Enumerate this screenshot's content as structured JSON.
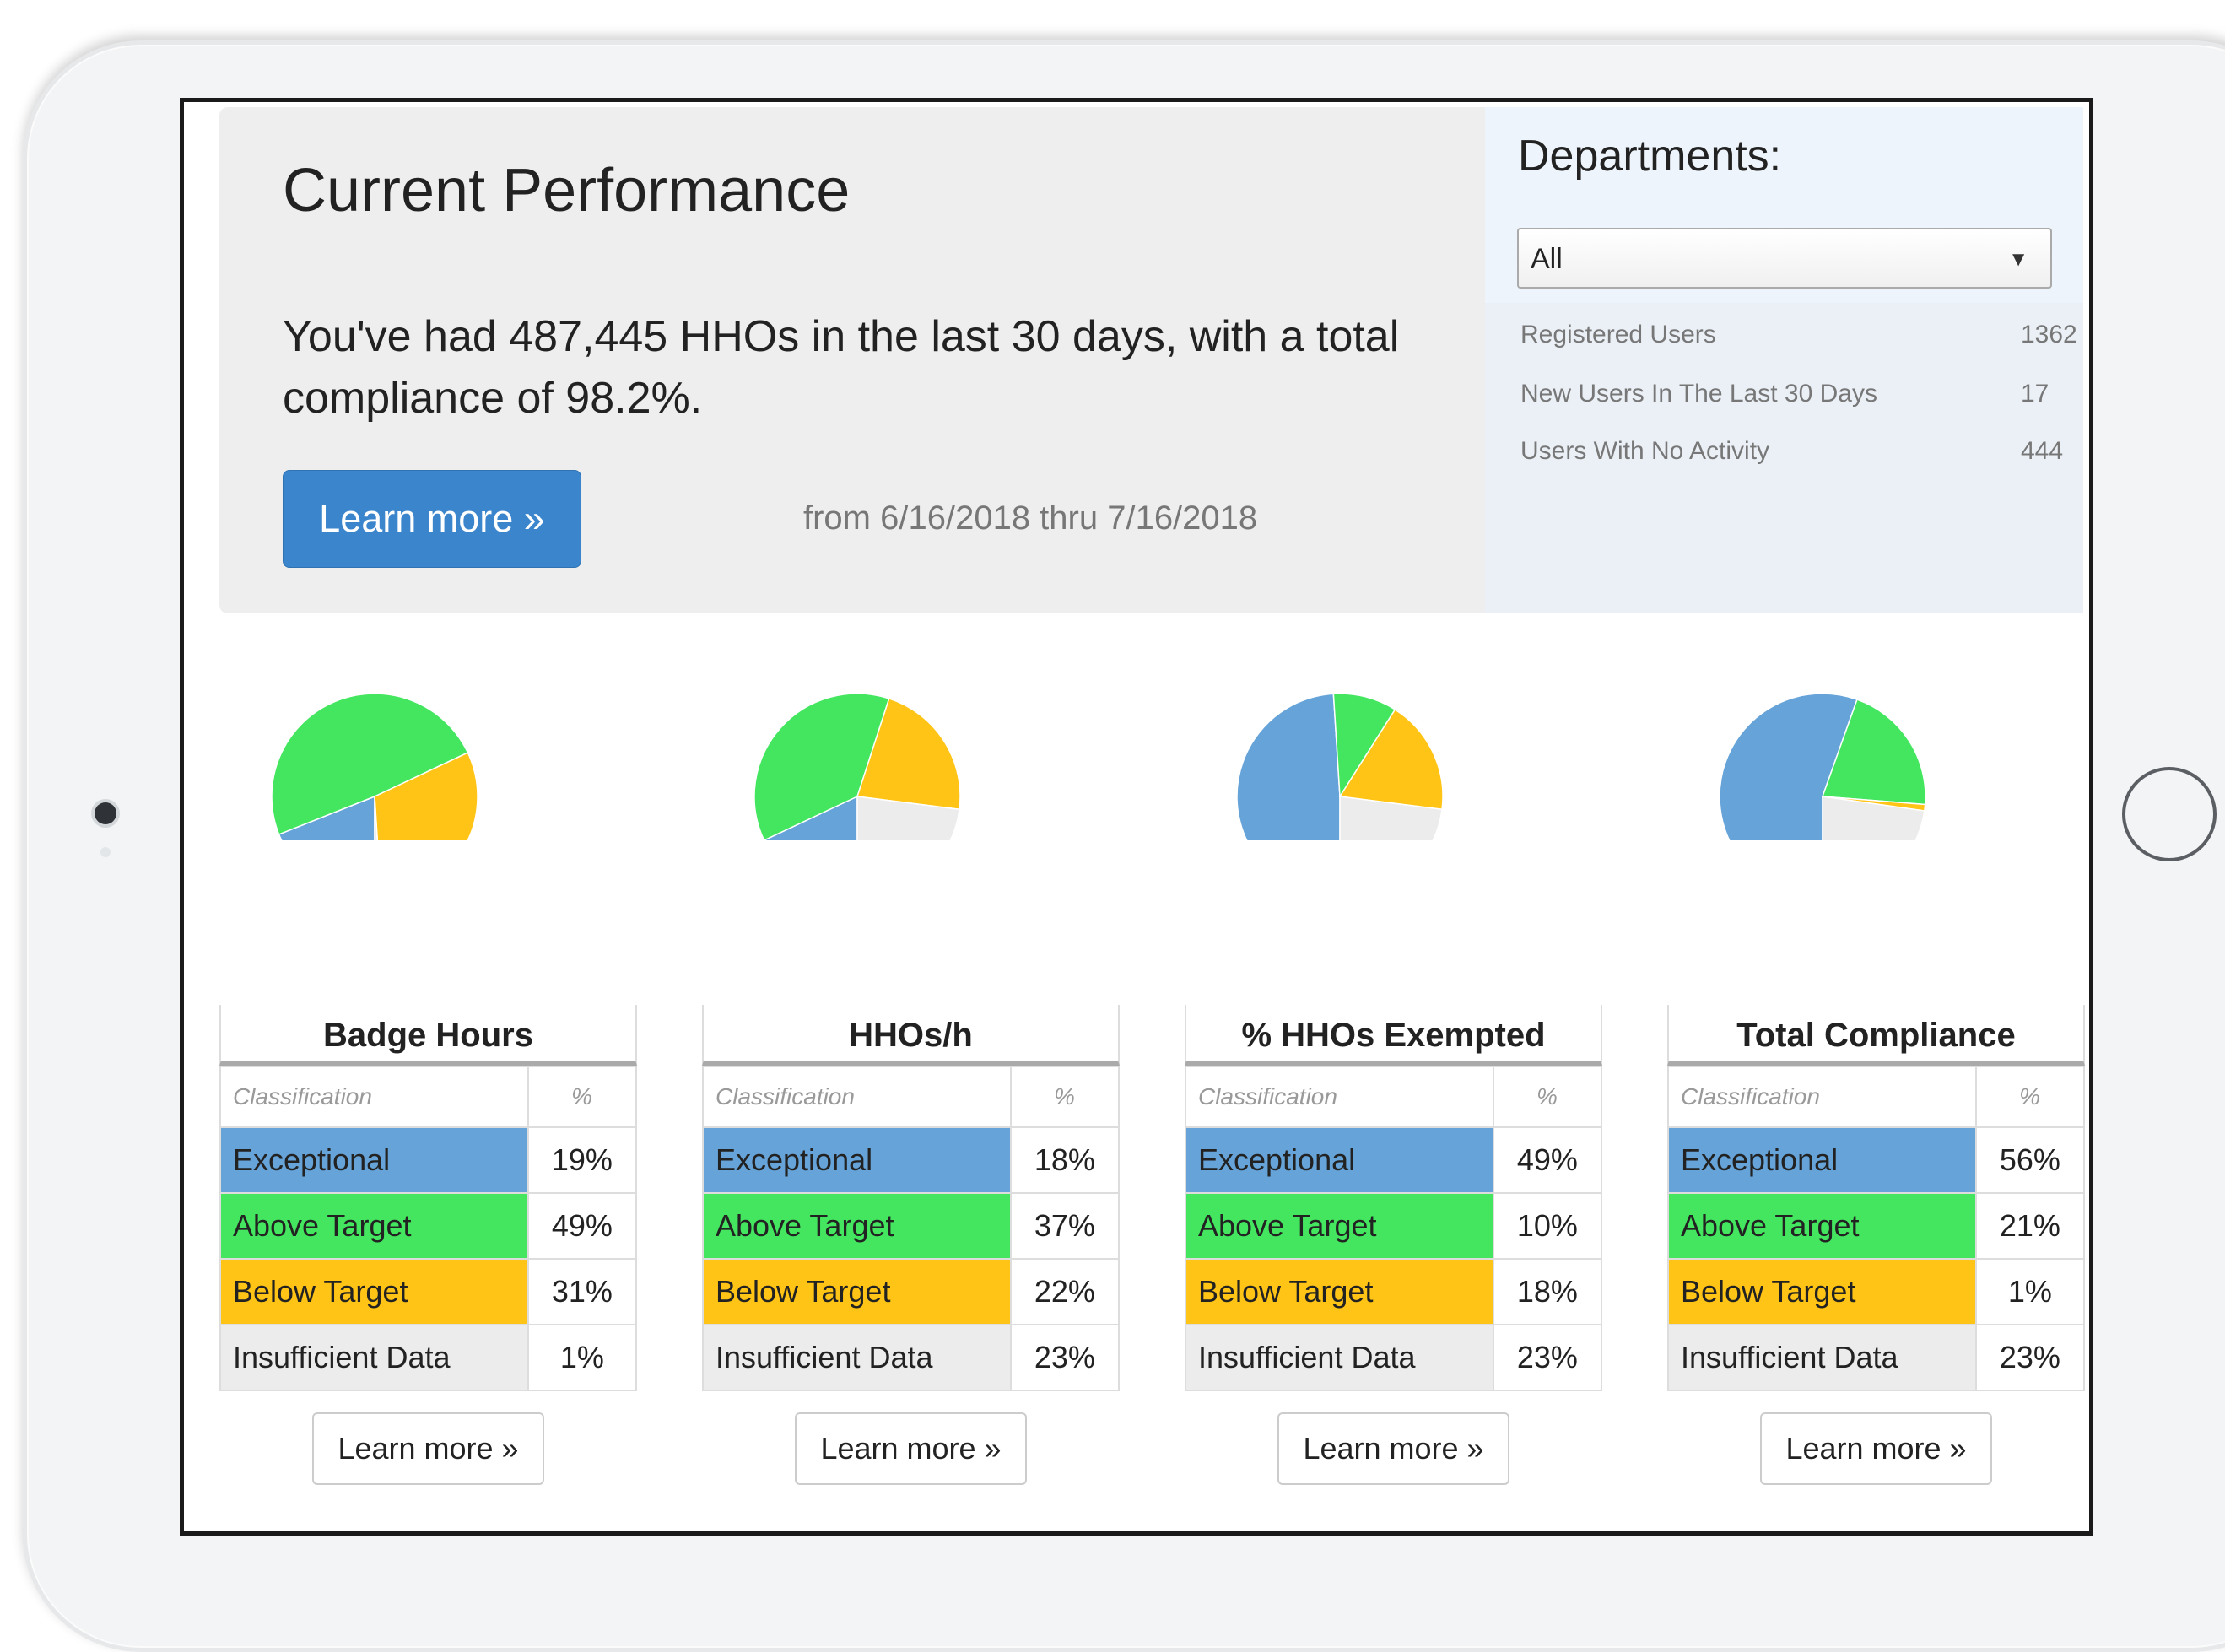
{
  "header": {
    "title": "Current Performance",
    "summary": "You've had 487,445 HHOs in the last 30 days, with a total compliance of 98.2%.",
    "primary_button": "Learn more »",
    "date_range": "from 6/16/2018 thru 7/16/2018"
  },
  "departments": {
    "title": "Departments:",
    "selected": "All",
    "stats": [
      {
        "label": "Registered Users",
        "value": "1362"
      },
      {
        "label": "New Users In The Last 30 Days",
        "value": "17"
      },
      {
        "label": "Users With No Activity",
        "value": "444"
      }
    ]
  },
  "colors": {
    "exceptional": "#66a3d8",
    "above_target": "#44e660",
    "below_target": "#ffc415",
    "insufficient_data": "#ececec"
  },
  "table_headers": {
    "classification": "Classification",
    "percent": "%"
  },
  "learn_more_label": "Learn more »",
  "cards": [
    {
      "title": "Badge Hours",
      "rows": [
        {
          "label": "Exceptional",
          "pct": "19%"
        },
        {
          "label": "Above Target",
          "pct": "49%"
        },
        {
          "label": "Below Target",
          "pct": "31%"
        },
        {
          "label": "Insufficient Data",
          "pct": "1%"
        }
      ]
    },
    {
      "title": "HHOs/h",
      "rows": [
        {
          "label": "Exceptional",
          "pct": "18%"
        },
        {
          "label": "Above Target",
          "pct": "37%"
        },
        {
          "label": "Below Target",
          "pct": "22%"
        },
        {
          "label": "Insufficient Data",
          "pct": "23%"
        }
      ]
    },
    {
      "title": "% HHOs Exempted",
      "rows": [
        {
          "label": "Exceptional",
          "pct": "49%"
        },
        {
          "label": "Above Target",
          "pct": "10%"
        },
        {
          "label": "Below Target",
          "pct": "18%"
        },
        {
          "label": "Insufficient Data",
          "pct": "23%"
        }
      ]
    },
    {
      "title": "Total Compliance",
      "rows": [
        {
          "label": "Exceptional",
          "pct": "56%"
        },
        {
          "label": "Above Target",
          "pct": "21%"
        },
        {
          "label": "Below Target",
          "pct": "1%"
        },
        {
          "label": "Insufficient Data",
          "pct": "23%"
        }
      ]
    }
  ],
  "chart_data": [
    {
      "type": "pie",
      "categories": [
        "Exceptional",
        "Above Target",
        "Below Target",
        "Insufficient Data"
      ],
      "values": [
        19,
        49,
        31,
        1
      ]
    },
    {
      "type": "pie",
      "categories": [
        "Exceptional",
        "Above Target",
        "Below Target",
        "Insufficient Data"
      ],
      "values": [
        18,
        37,
        22,
        23
      ]
    },
    {
      "type": "pie",
      "categories": [
        "Exceptional",
        "Above Target",
        "Below Target",
        "Insufficient Data"
      ],
      "values": [
        49,
        10,
        18,
        23
      ]
    },
    {
      "type": "pie",
      "categories": [
        "Exceptional",
        "Above Target",
        "Below Target",
        "Insufficient Data"
      ],
      "values": [
        56,
        21,
        1,
        23
      ]
    }
  ]
}
